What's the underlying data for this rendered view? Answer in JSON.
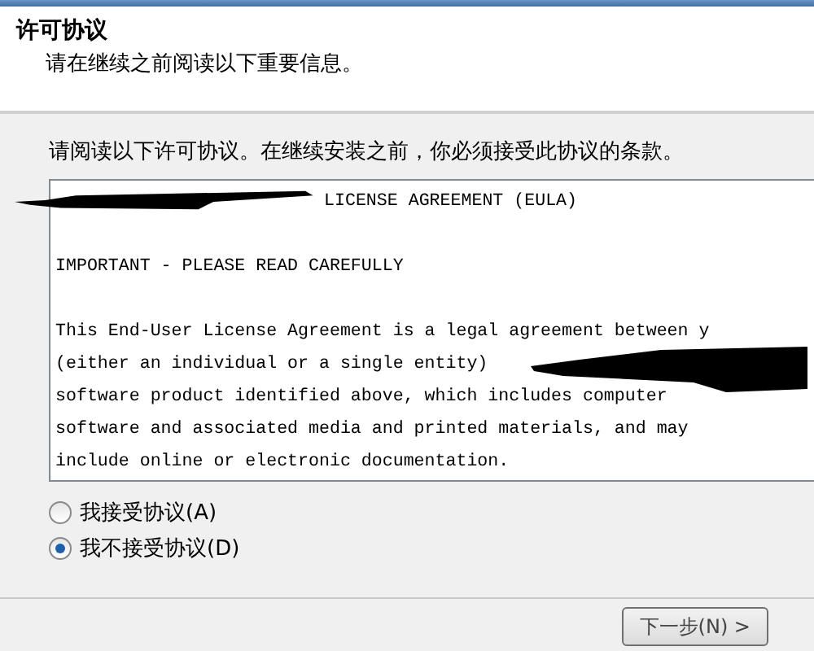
{
  "header": {
    "title": "许可协议",
    "subtitle": "请在继续之前阅读以下重要信息。"
  },
  "instruction": "请阅读以下许可协议。在继续安装之前，你必须接受此协议的条款。",
  "license_paragraphs": [
    [
      "LICENSE AGREEMENT (EULA)"
    ],
    [
      "IMPORTANT - PLEASE READ CAREFULLY"
    ],
    [
      "This End-User License Agreement is a legal agreement between y",
      "(either an individual or a single entity)",
      "software product identified above, which includes computer",
      "software and associated media and printed materials, and may",
      "include online or electronic documentation."
    ]
  ],
  "options": [
    {
      "label": "我接受协议(A)",
      "selected": false
    },
    {
      "label": "我不接受协议(D)",
      "selected": true
    }
  ],
  "buttons": [
    {
      "label": "下一步(N) >"
    }
  ]
}
